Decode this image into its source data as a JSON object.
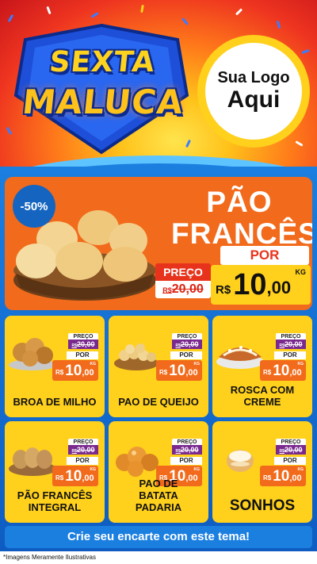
{
  "hero": {
    "title_line1": "SEXTA",
    "title_line2": "MALUCA",
    "logo_line1": "Sua Logo",
    "logo_line2": "Aqui"
  },
  "featured": {
    "discount": "-50%",
    "name_line1": "PÃO",
    "name_line2": "FRANCÊS",
    "preco_label": "PREÇO",
    "old_price_currency": "R$",
    "old_price_value": "20,00",
    "por_label": "POR",
    "currency": "R$",
    "price_int": "10",
    "price_dec": ",00",
    "unit": "KG"
  },
  "products": [
    {
      "name": "BROA DE MILHO",
      "preco_label": "PREÇO",
      "old_currency": "R$",
      "old_price": "20,00",
      "por_label": "POR",
      "currency": "R$",
      "price_int": "10",
      "price_dec": ",00",
      "unit": "KG",
      "image": "broa-image"
    },
    {
      "name": "PAO DE QUEIJO",
      "preco_label": "PREÇO",
      "old_currency": "R$",
      "old_price": "20,00",
      "por_label": "POR",
      "currency": "R$",
      "price_int": "10",
      "price_dec": ",00",
      "unit": "KG",
      "image": "pao-de-queijo-image"
    },
    {
      "name": "ROSCA COM CREME",
      "preco_label": "PREÇO",
      "old_currency": "R$",
      "old_price": "20,00",
      "por_label": "POR",
      "currency": "R$",
      "price_int": "10",
      "price_dec": ",00",
      "unit": "KG",
      "image": "rosca-image"
    },
    {
      "name": "PÃO FRANCÊS INTEGRAL",
      "preco_label": "PREÇO",
      "old_currency": "R$",
      "old_price": "20,00",
      "por_label": "POR",
      "currency": "R$",
      "price_int": "10",
      "price_dec": ",00",
      "unit": "KG",
      "image": "pao-integral-image"
    },
    {
      "name": "PAO DE BATATA PADARIA",
      "preco_label": "PREÇO",
      "old_currency": "R$",
      "old_price": "20,00",
      "por_label": "POR",
      "currency": "R$",
      "price_int": "10",
      "price_dec": ",00",
      "unit": "KG",
      "image": "pao-batata-image"
    },
    {
      "name": "SONHOS",
      "preco_label": "PREÇO",
      "old_currency": "R$",
      "old_price": "20,00",
      "por_label": "POR",
      "currency": "R$",
      "price_int": "10",
      "price_dec": ",00",
      "unit": "KG",
      "image": "sonho-image"
    }
  ],
  "cta": {
    "label": "Crie seu encarte com este tema!"
  },
  "footer": {
    "disclaimer": "*Imagens Meramente Ilustrativas"
  },
  "colors": {
    "accent_yellow": "#ffd01c",
    "accent_orange": "#f26a1b",
    "brand_blue": "#1565c0",
    "old_price_purple": "#7a2a8f",
    "strike_red": "#e8331c"
  }
}
